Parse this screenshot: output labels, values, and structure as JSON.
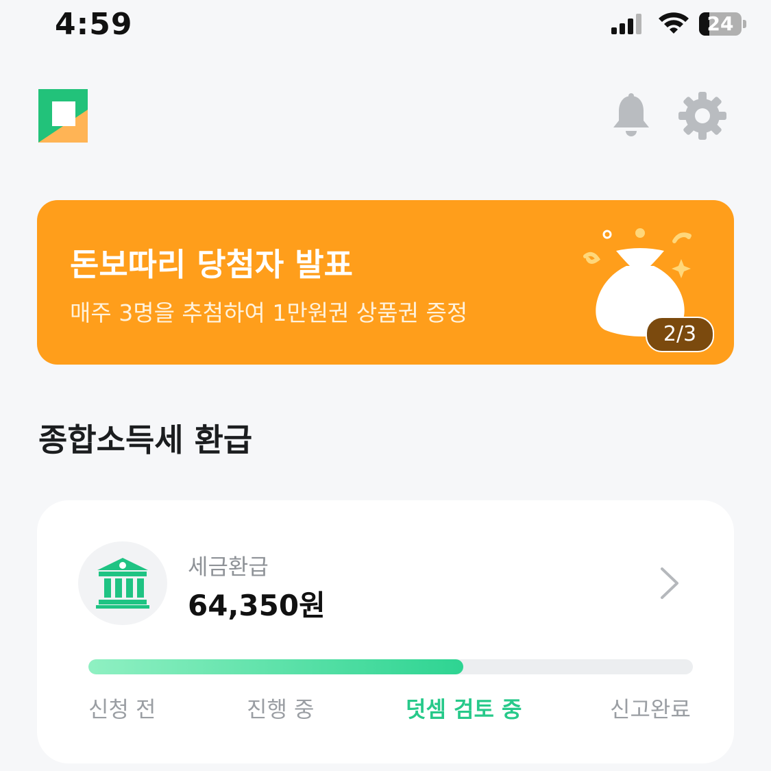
{
  "status_bar": {
    "time": "4:59",
    "battery_percent": "24",
    "battery_level": 0.24
  },
  "header": {
    "logo_icon": "app-logo",
    "notification_icon": "bell-icon",
    "settings_icon": "gear-icon"
  },
  "banner": {
    "title": "돈보따리 당첨자 발표",
    "subtitle": "매주 3명을 추첨하여 1만원권 상품권 증정",
    "pager": "2/3",
    "image_icon": "money-bag-icon",
    "background_color": "#ff9e1b"
  },
  "section": {
    "title": "종합소득세 환급"
  },
  "refund_card": {
    "icon": "bank-icon",
    "label": "세금환급",
    "amount": "64,350원",
    "progress_fraction": 0.62,
    "steps": [
      {
        "label": "신청 전",
        "active": false
      },
      {
        "label": "진행 중",
        "active": false
      },
      {
        "label": "덧셈 검토 중",
        "active": true
      },
      {
        "label": "신고완료",
        "active": false
      }
    ],
    "accent_color": "#27c98a"
  }
}
